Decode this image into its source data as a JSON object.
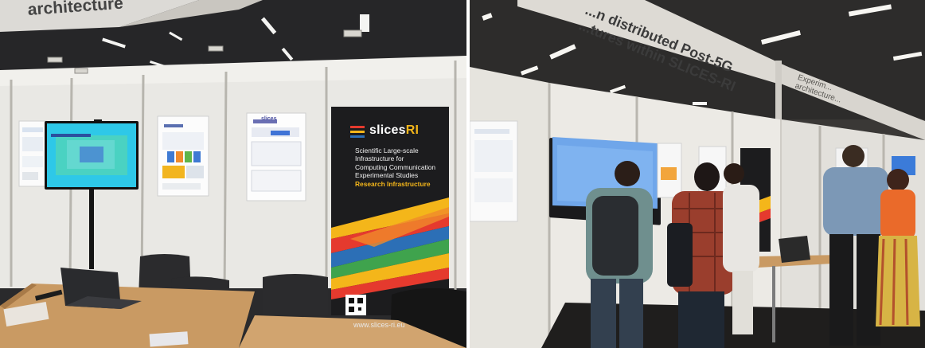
{
  "left_photo": {
    "header_banner_text": "architecture",
    "rollup_banner": {
      "brand_slices": "slices",
      "brand_ri": "RI",
      "slogan_lines": [
        "Scientific Large-scale",
        "Infrastructure for",
        "Computing Communication",
        "Experimental Studies"
      ],
      "tagline": "Research Infrastructure",
      "url": "www.slices-ri.eu"
    },
    "poster_brand": "slices"
  },
  "right_photo": {
    "header_banner_lines": [
      "...n distributed Post-5G",
      "...tures within SLICES-RI"
    ],
    "side_banner_lines": [
      "Experim...",
      "architecture..."
    ]
  },
  "colors": {
    "rollup_background": "#1c1c1e",
    "stripe_yellow": "#f4b61a",
    "stripe_red": "#e53a2e",
    "stripe_blue": "#2c6fb6",
    "stripe_green": "#3fa34d",
    "table": "#c99a63",
    "wall": "#e9e8e4"
  }
}
